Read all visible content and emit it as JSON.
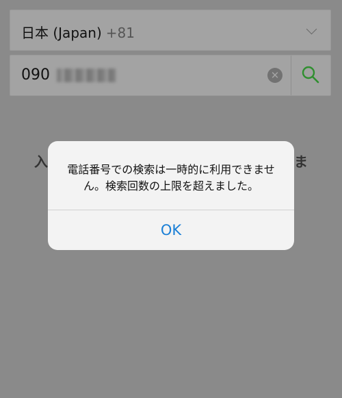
{
  "country": {
    "name": "日本 (Japan)",
    "code": "+81"
  },
  "phone": {
    "value": "090"
  },
  "background": {
    "left_text": "入",
    "right_text": "ま"
  },
  "dialog": {
    "message": "電話番号での検索は一時的に利用できません。検索回数の上限を超えました。",
    "ok_label": "OK"
  }
}
